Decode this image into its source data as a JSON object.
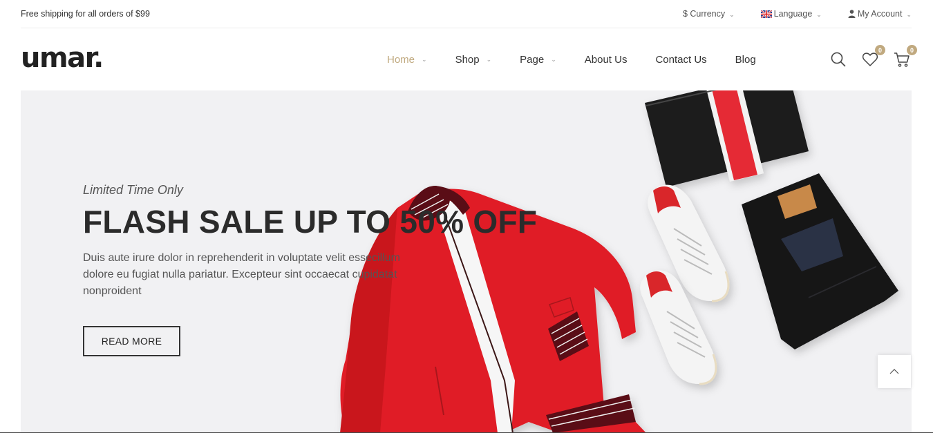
{
  "topbar": {
    "shipping": "Free shipping for all orders of $99",
    "currency": "$ Currency",
    "language": "Language",
    "account": "My Account"
  },
  "header": {
    "logo": "umar.",
    "nav": [
      {
        "label": "Home",
        "active": true
      },
      {
        "label": "Shop"
      },
      {
        "label": "Page"
      },
      {
        "label": "About Us"
      },
      {
        "label": "Contact Us"
      },
      {
        "label": "Blog"
      }
    ],
    "wishlist_count": "0",
    "cart_count": "0"
  },
  "hero": {
    "subtitle": "Limited Time Only",
    "headline": "FLASH SALE UP TO 50% OFF",
    "description": "Duis aute irure dolor in reprehenderit in voluptate velit essecillum dolore eu fugiat nulla pariatur. Excepteur sint occaecat cupidatat nonproident",
    "button": "READ MORE"
  },
  "colors": {
    "accent": "#c0a97f",
    "hero_bg": "#f1f1f3",
    "jacket_red": "#e0202a"
  }
}
